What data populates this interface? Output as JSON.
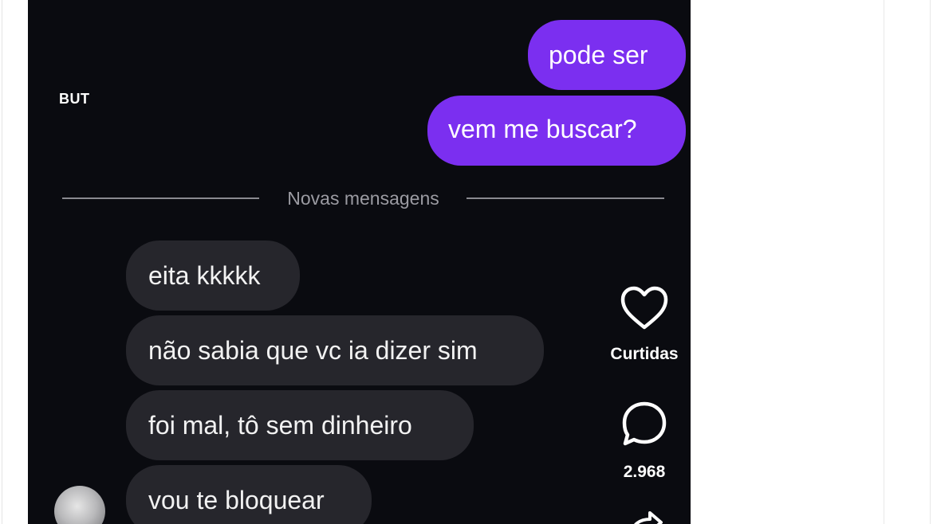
{
  "header": {
    "side_text": "BUT"
  },
  "messages_sent": [
    {
      "text": "pode ser"
    },
    {
      "text": "vem me buscar?"
    }
  ],
  "divider": {
    "label": "Novas mensagens"
  },
  "messages_received": [
    {
      "text": "eita kkkkk"
    },
    {
      "text": "não sabia que vc ia dizer sim"
    },
    {
      "text": "foi mal, tô sem dinheiro"
    },
    {
      "text": "vou te bloquear"
    }
  ],
  "actions": {
    "like": {
      "icon": "heart-icon",
      "label": "Curtidas"
    },
    "comment": {
      "icon": "comment-icon",
      "count": "2.968"
    },
    "share": {
      "icon": "share-icon"
    }
  },
  "colors": {
    "sent_bubble": "#7b2ff0",
    "received_bubble": "#26262c",
    "background": "#0a0b10"
  }
}
